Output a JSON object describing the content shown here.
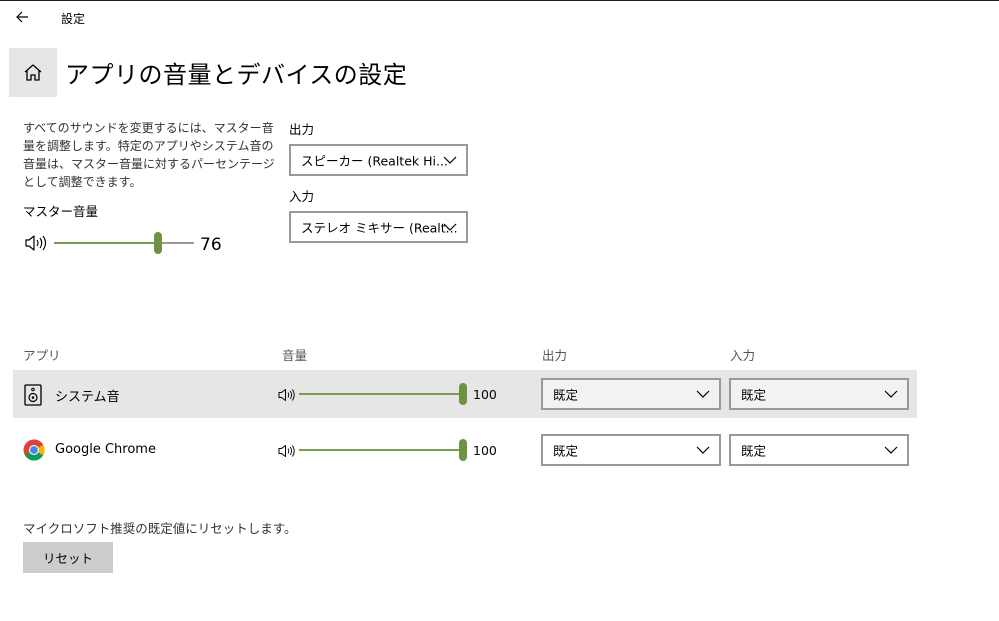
{
  "window": {
    "title": "設定"
  },
  "header": {
    "title": "アプリの音量とデバイスの設定"
  },
  "master": {
    "description": "すべてのサウンドを変更するには、マスター音量を調整します。特定のアプリやシステム音の音量は、マスター音量に対するパーセンテージとして調整できます。",
    "label": "マスター音量",
    "value": 76,
    "value_text": "76"
  },
  "output": {
    "label": "出力",
    "selected": "スピーカー (Realtek Hi..."
  },
  "input": {
    "label": "入力",
    "selected": "ステレオ ミキサー (Realt..."
  },
  "table": {
    "headers": {
      "app": "アプリ",
      "volume": "音量",
      "output": "出力",
      "input": "入力"
    },
    "rows": [
      {
        "name": "システム音",
        "volume": 100,
        "volume_text": "100",
        "output": "既定",
        "input": "既定"
      },
      {
        "name": "Google Chrome",
        "volume": 100,
        "volume_text": "100",
        "output": "既定",
        "input": "既定"
      }
    ]
  },
  "reset": {
    "description": "マイクロソフト推奨の既定値にリセットします。",
    "button_label": "リセット"
  },
  "colors": {
    "accent": "#6f9142",
    "track_fill": "#7c9b4e",
    "row_highlight": "#e6e6e6",
    "button_bg": "#cccccc"
  }
}
